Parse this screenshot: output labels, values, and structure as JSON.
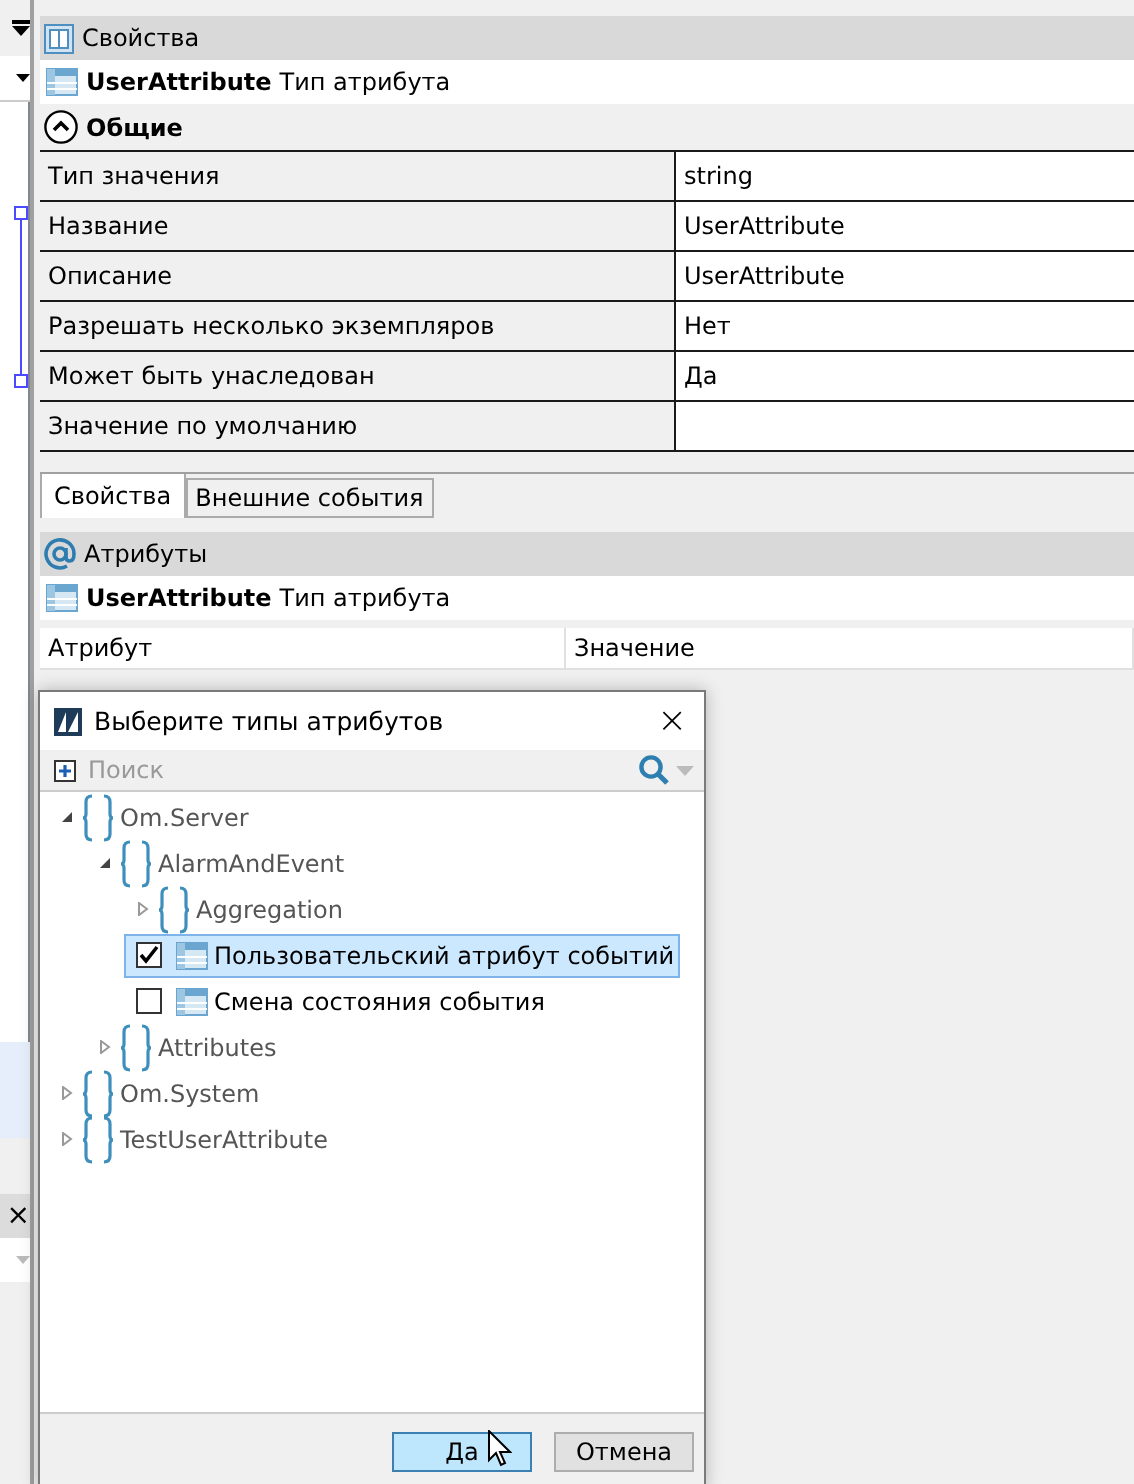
{
  "side_strip": {
    "close_glyph": "×"
  },
  "properties": {
    "title": "Свойства",
    "object": {
      "name": "UserAttribute",
      "type": "Тип атрибута"
    },
    "section": {
      "title": "Общие",
      "expanded": true
    },
    "rows": [
      {
        "label": "Тип значения",
        "value": "string"
      },
      {
        "label": "Название",
        "value": "UserAttribute"
      },
      {
        "label": "Описание",
        "value": "UserAttribute"
      },
      {
        "label": "Разрешать несколько экземпляров",
        "value": "Нет"
      },
      {
        "label": "Может быть унаследован",
        "value": "Да"
      },
      {
        "label": "Значение по умолчанию",
        "value": ""
      }
    ],
    "tabs": [
      {
        "label": "Свойства",
        "selected": true
      },
      {
        "label": "Внешние события",
        "selected": false
      }
    ]
  },
  "attributes": {
    "title": "Атрибуты",
    "object": {
      "name": "UserAttribute",
      "type": "Тип атрибута"
    },
    "columns": [
      "Атрибут",
      "Значение"
    ]
  },
  "dialog": {
    "title": "Выберите типы атрибутов",
    "close_glyph": "×",
    "search": {
      "placeholder": "Поиск"
    },
    "tree": [
      {
        "kind": "namespace",
        "label": "Om.Server",
        "expanded": true,
        "children": [
          {
            "kind": "namespace",
            "label": "AlarmAndEvent",
            "expanded": true,
            "children": [
              {
                "kind": "namespace",
                "label": "Aggregation",
                "expanded": false
              },
              {
                "kind": "type",
                "label": "Пользовательский атрибут событий",
                "checked": true,
                "selected": true
              },
              {
                "kind": "type",
                "label": "Смена состояния события",
                "checked": false,
                "selected": false
              }
            ]
          },
          {
            "kind": "namespace",
            "label": "Attributes",
            "expanded": false
          }
        ]
      },
      {
        "kind": "namespace",
        "label": "Om.System",
        "expanded": false
      },
      {
        "kind": "namespace",
        "label": "TestUserAttribute",
        "expanded": false
      }
    ],
    "buttons": [
      {
        "label": "Да",
        "selected": true
      },
      {
        "label": "Отмена",
        "selected": false
      }
    ]
  }
}
